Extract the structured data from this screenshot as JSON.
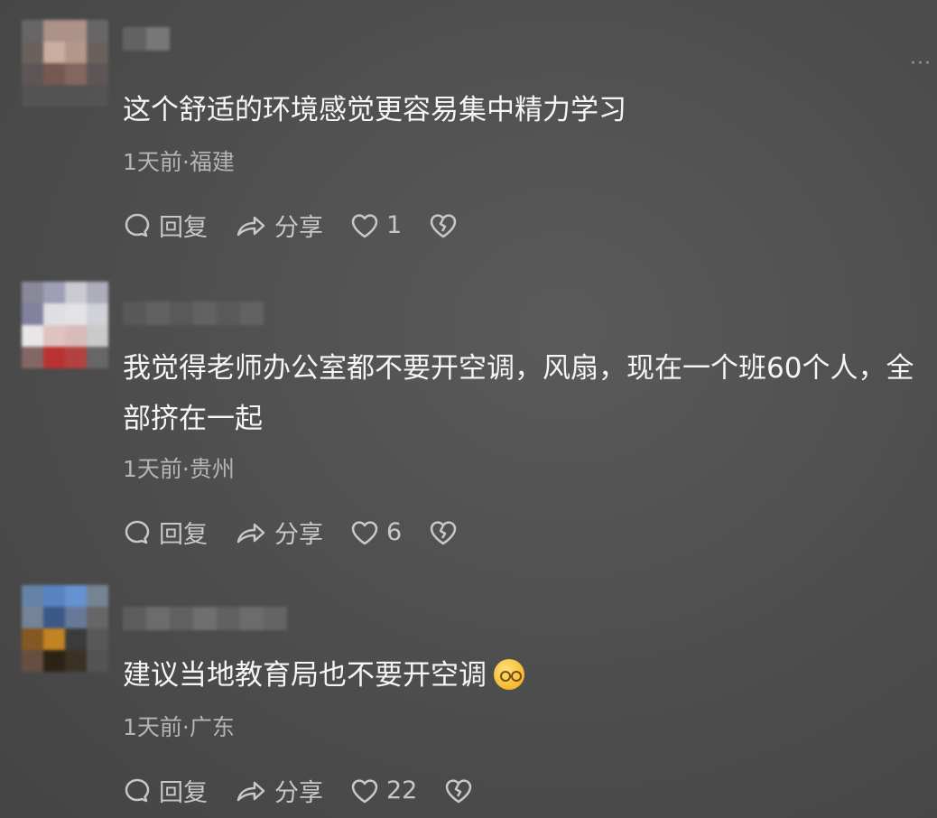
{
  "more_label": "···",
  "actions": {
    "reply": "回复",
    "share": "分享"
  },
  "comments": [
    {
      "text": "这个舒适的环境感觉更容易集中精力学习",
      "time_location": "1天前·福建",
      "likes": "1"
    },
    {
      "text": "我觉得老师办公室都不要开空调，风扇，现在一个班60个人，全部挤在一起",
      "time_location": "1天前·贵州",
      "likes": "6"
    },
    {
      "text": "建议当地教育局也不要开空调",
      "time_location": "1天前·广东",
      "likes": "22",
      "emoji": "thinking-face-emoji"
    }
  ]
}
